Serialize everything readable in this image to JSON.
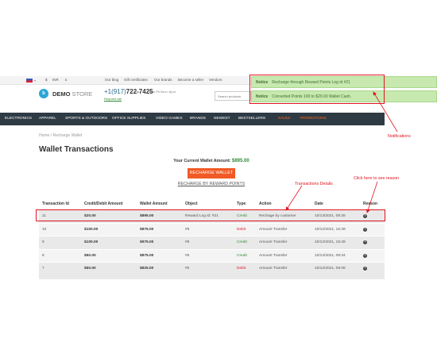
{
  "topbar": {
    "currency": "$",
    "lang": "INR",
    "sep": "£",
    "links": [
      "Our blog",
      "Gift certificates",
      "Our brands",
      "Become a seller",
      "Vendors"
    ]
  },
  "header": {
    "logo_glyph": "b",
    "store_name_bold": "DEMO",
    "store_name_thin": "STORE",
    "phone_prefix": "+1(917)",
    "phone_number": "722-7425",
    "phone_hours": "Mon-Fri 9a.m.-6p.m.",
    "request_call": "Request call",
    "search_placeholder": "Search products"
  },
  "notices": [
    {
      "label": "Notice",
      "text": "Recharge through Reward Points Log id #21"
    },
    {
      "label": "Notice",
      "text": "Converted Points 100 to $20.00 Wallet Cash."
    }
  ],
  "nav": [
    "Electronics",
    "Apparel",
    "Sports & Outdoors",
    "Office Supplies",
    "Video Games",
    "Brands",
    "Newest",
    "Bestsellers",
    "Sales",
    "Promotions"
  ],
  "breadcrumb": "Home / Recharge Wallet",
  "page_title": "Wallet Transactions",
  "wallet": {
    "label": "Your Current Wallet Amount:",
    "amount": "$895.00",
    "recharge_button": "RECHARGE WALLET",
    "reward_link": "RECHARGE BY REWARD POINTS"
  },
  "table": {
    "headers": [
      "Transaction Id",
      "Credit/Debit Amount",
      "Wallet Amount",
      "Object",
      "Type",
      "Action",
      "Date",
      "Reason"
    ],
    "rows": [
      {
        "id": "11",
        "amount": "$20.00",
        "wallet": "$895.00",
        "object": "Reward Log Id: #21",
        "type": "Credit",
        "action": "Rechage by customer",
        "date": "10/13/2021, 09:26"
      },
      {
        "id": "10",
        "amount": "$100.00",
        "wallet": "$875.00",
        "object": "#6",
        "type": "Debit",
        "action": "Amount Transfer",
        "date": "10/12/2021, 15:49"
      },
      {
        "id": "9",
        "amount": "$100.00",
        "wallet": "$975.00",
        "object": "#6",
        "type": "Credit",
        "action": "Amount Transfer",
        "date": "10/12/2021, 15:49"
      },
      {
        "id": "8",
        "amount": "$50.00",
        "wallet": "$875.00",
        "object": "#5",
        "type": "Credit",
        "action": "Amount Transfer",
        "date": "10/12/2021, 09:34"
      },
      {
        "id": "7",
        "amount": "$50.00",
        "wallet": "$825.00",
        "object": "#5",
        "type": "Debit",
        "action": "Amount Transfer",
        "date": "10/12/2021, 09:08"
      }
    ]
  },
  "annotations": {
    "notifications": "Notifications",
    "transactions_details": "Transactions Details",
    "click_reason": "Click here to see reason"
  },
  "colors": {
    "accent": "#f15a24",
    "credit": "#2e8b2e",
    "debit": "#e0141e",
    "notice_bg": "#c7e9b0",
    "nav_bg": "#2e3a44"
  }
}
